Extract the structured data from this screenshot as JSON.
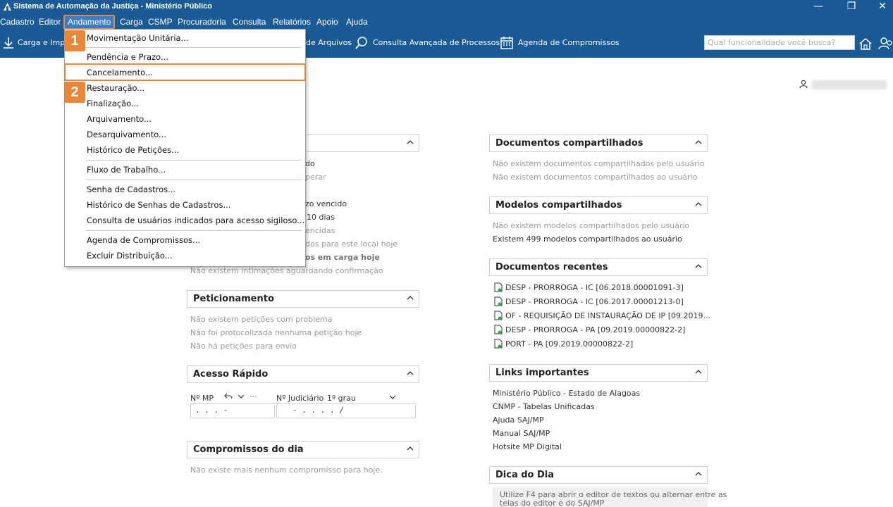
{
  "window": {
    "title": "Sistema de Automação da Justiça - Ministério Público",
    "minimize": "—",
    "restore": "❐",
    "close": "✕"
  },
  "menubar": {
    "items": [
      "Cadastro",
      "Editor",
      "Andamento",
      "Carga",
      "CSMP",
      "Procuradoria",
      "Consulta",
      "Relatórios",
      "Apoio",
      "Ajuda"
    ],
    "active": "Andamento"
  },
  "toolbar": {
    "carga": "Carga e Impo",
    "arquivos": "de Arquivos",
    "consulta_avancada": "Consulta Avançada de Processos",
    "agenda": "Agenda de Compromissos",
    "search_placeholder": "Qual funcionalidade você busca?"
  },
  "dropdown": {
    "items": [
      "Movimentação Unitária...",
      "Pendência e Prazo...",
      "Cancelamento...",
      "Restauração...",
      "Finalização...",
      "Arquivamento...",
      "Desarquivamento...",
      "Histórico de Petições...",
      "Fluxo de Trabalho...",
      "Senha de Cadastros...",
      "Histórico de Senhas de Cadastros...",
      "Consulta de usuários indicados para acesso sigiloso...",
      "Agenda de Compromissos...",
      "Excluir Distribuição..."
    ],
    "highlighted": "Cancelamento...",
    "badge1": "1",
    "badge2": "2"
  },
  "left_panel_partial": {
    "lines": [
      "do",
      "perar",
      "zo vencido",
      "10 dias",
      "encidas",
      "dos para este local hoje",
      "os em carga hoje",
      "Não existem intimações aguardando confirmação"
    ]
  },
  "peticionamento": {
    "title": "Peticionamento",
    "lines": [
      "Não existem petições com problema",
      "Não foi protocolizada nenhuma petição hoje",
      "Não há petições para envio"
    ]
  },
  "acesso_rapido": {
    "title": "Acesso Rápido",
    "nr_mp_label": "Nº MP",
    "nr_judiciario_label": "Nº Judiciário",
    "grau": "1º grau",
    "more": "···",
    "nr_mp_value": ".   .   .     -",
    "nr_jud_value": "-  .  .  .  .   /"
  },
  "compromissos": {
    "title": "Compromissos do dia",
    "lines": [
      "Não existe mais nenhum compromisso para hoje."
    ]
  },
  "docs_compartilhados": {
    "title": "Documentos compartilhados",
    "lines": [
      "Não existem documentos compartilhados pelo usuário",
      "Não existem documentos compartilhados ao usuário"
    ]
  },
  "modelos_compartilhados": {
    "title": "Modelos compartilhados",
    "lines": [
      "Não existem modelos compartilhados pelo usuário",
      "Existem 499 modelos compartilhados ao usuário"
    ]
  },
  "docs_recentes": {
    "title": "Documentos recentes",
    "items": [
      "DESP - PRORROGA - IC [06.2018.00001091-3]",
      "DESP - PRORROGA - IC [06.2017.00001213-0]",
      "OF - REQUISIÇÃO DE INSTAURAÇÃO DE IP [09.2019...",
      "DESP - PRORROGA - PA [09.2019.00000822-2]",
      "PORT - PA [09.2019.00000822-2]"
    ]
  },
  "links": {
    "title": "Links importantes",
    "items": [
      "Ministério Público - Estado de Alagoas",
      "CNMP - Tabelas Unificadas",
      "Ajuda SAJ/MP",
      "Manual SAJ/MP",
      "Hotsite MP Digital"
    ]
  },
  "dica": {
    "title": "Dica do Dia",
    "line1": "Utilize F4 para abrir o editor de textos ou alternar entre as",
    "line2": "telas do editor e do SAJ/MP"
  },
  "colors": {
    "bar": "#1a5a97",
    "accent": "#e8873a"
  }
}
